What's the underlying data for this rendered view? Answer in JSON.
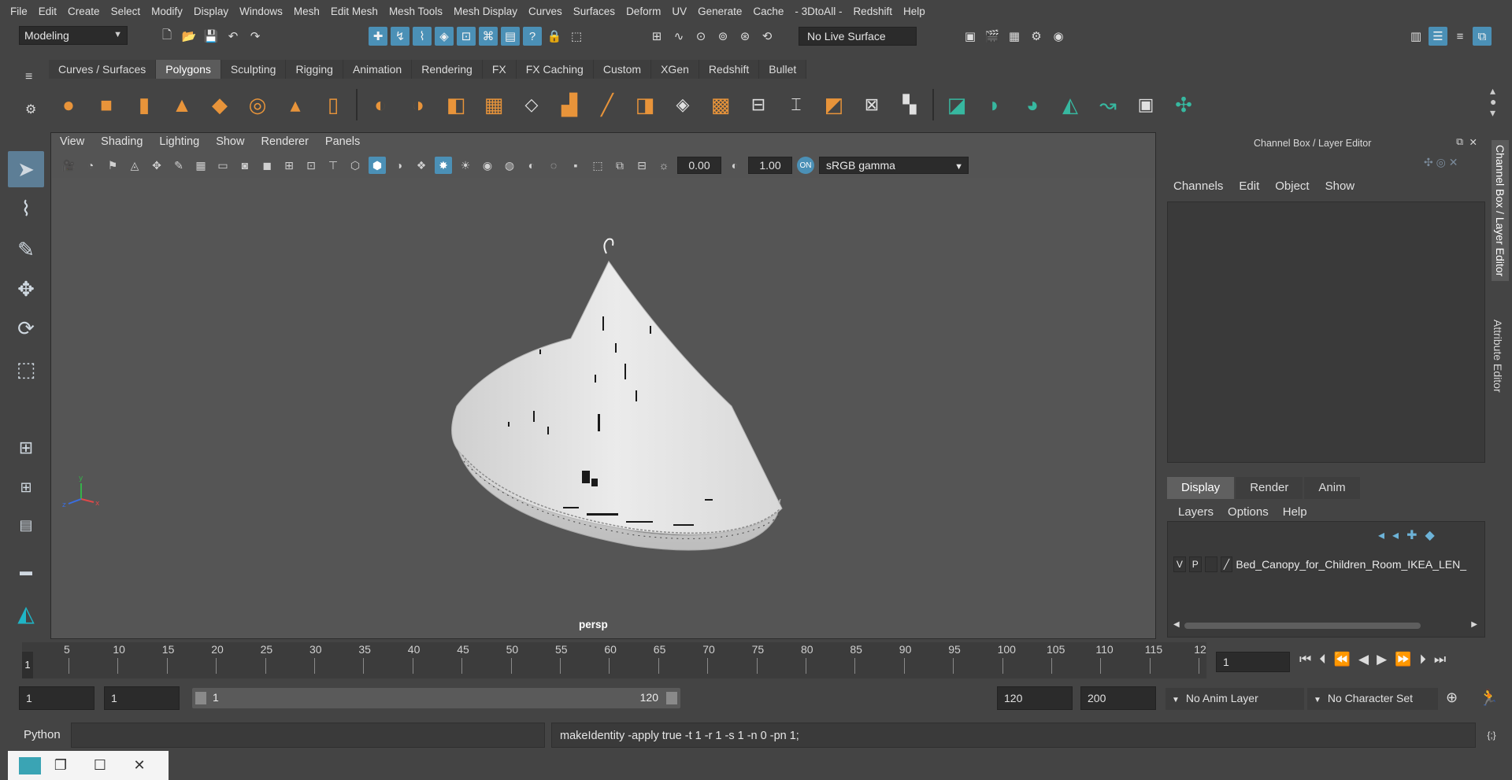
{
  "menubar": [
    "File",
    "Edit",
    "Create",
    "Select",
    "Modify",
    "Display",
    "Windows",
    "Mesh",
    "Edit Mesh",
    "Mesh Tools",
    "Mesh Display",
    "Curves",
    "Surfaces",
    "Deform",
    "UV",
    "Generate",
    "Cache",
    "- 3DtoAll -",
    "Redshift",
    "Help"
  ],
  "statusline": {
    "mode": "Modeling",
    "live_surface": "No Live Surface"
  },
  "shelf": {
    "tabs": [
      "Curves / Surfaces",
      "Polygons",
      "Sculpting",
      "Rigging",
      "Animation",
      "Rendering",
      "FX",
      "FX Caching",
      "Custom",
      "XGen",
      "Redshift",
      "Bullet"
    ],
    "active_tab": "Polygons"
  },
  "viewport": {
    "menu": [
      "View",
      "Shading",
      "Lighting",
      "Show",
      "Renderer",
      "Panels"
    ],
    "exposure": "0.00",
    "gamma_value": "1.00",
    "color_space": "sRGB gamma",
    "camera_label": "persp"
  },
  "right_panel": {
    "title": "Channel Box / Layer Editor",
    "channel_menu": [
      "Channels",
      "Edit",
      "Object",
      "Show"
    ],
    "layer_tabs": [
      "Display",
      "Render",
      "Anim"
    ],
    "layer_menu": [
      "Layers",
      "Options",
      "Help"
    ],
    "layer": {
      "v": "V",
      "p": "P",
      "name": "Bed_Canopy_for_Children_Room_IKEA_LEN_"
    },
    "side_tabs": [
      "Channel Box / Layer Editor",
      "Attribute Editor"
    ]
  },
  "timeline": {
    "ticks": [
      "5",
      "10",
      "15",
      "20",
      "25",
      "30",
      "35",
      "40",
      "45",
      "50",
      "55",
      "60",
      "65",
      "70",
      "75",
      "80",
      "85",
      "90",
      "95",
      "100",
      "105",
      "110",
      "115",
      "12"
    ],
    "current_frame": "1",
    "frame_field": "1"
  },
  "range": {
    "start": "1",
    "playback_start": "1",
    "range_start": "1",
    "range_end": "120",
    "playback_end": "120",
    "end": "200",
    "anim_layer": "No Anim Layer",
    "character_set": "No Character Set"
  },
  "command": {
    "label": "Python",
    "output": "makeIdentity -apply true -t 1 -r 1 -s 1 -n 0 -pn 1;"
  },
  "colors": {
    "accent": "#4b90b6",
    "shelf_icon": "#e8943a",
    "bg": "#444444"
  }
}
